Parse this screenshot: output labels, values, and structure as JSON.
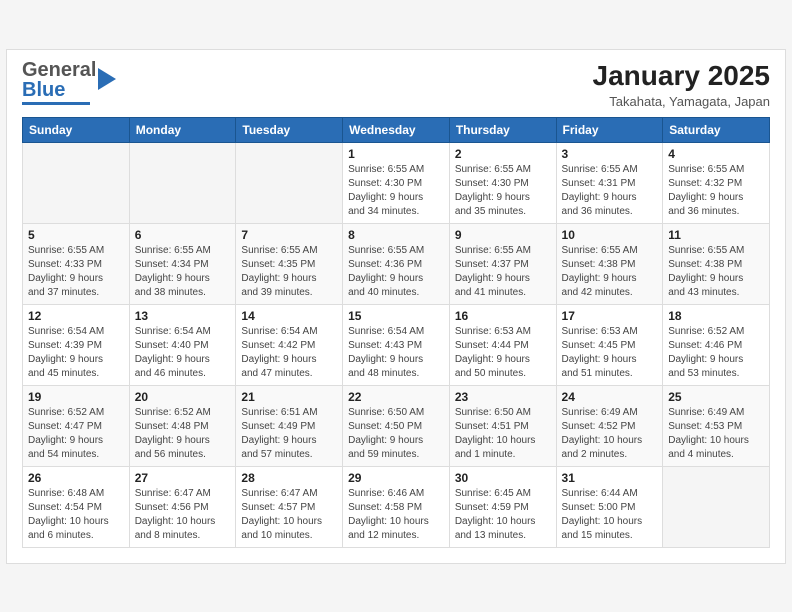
{
  "header": {
    "logo_general": "General",
    "logo_blue": "Blue",
    "month_title": "January 2025",
    "location": "Takahata, Yamagata, Japan"
  },
  "weekdays": [
    "Sunday",
    "Monday",
    "Tuesday",
    "Wednesday",
    "Thursday",
    "Friday",
    "Saturday"
  ],
  "weeks": [
    [
      {
        "day": "",
        "info": ""
      },
      {
        "day": "",
        "info": ""
      },
      {
        "day": "",
        "info": ""
      },
      {
        "day": "1",
        "info": "Sunrise: 6:55 AM\nSunset: 4:30 PM\nDaylight: 9 hours\nand 34 minutes."
      },
      {
        "day": "2",
        "info": "Sunrise: 6:55 AM\nSunset: 4:30 PM\nDaylight: 9 hours\nand 35 minutes."
      },
      {
        "day": "3",
        "info": "Sunrise: 6:55 AM\nSunset: 4:31 PM\nDaylight: 9 hours\nand 36 minutes."
      },
      {
        "day": "4",
        "info": "Sunrise: 6:55 AM\nSunset: 4:32 PM\nDaylight: 9 hours\nand 36 minutes."
      }
    ],
    [
      {
        "day": "5",
        "info": "Sunrise: 6:55 AM\nSunset: 4:33 PM\nDaylight: 9 hours\nand 37 minutes."
      },
      {
        "day": "6",
        "info": "Sunrise: 6:55 AM\nSunset: 4:34 PM\nDaylight: 9 hours\nand 38 minutes."
      },
      {
        "day": "7",
        "info": "Sunrise: 6:55 AM\nSunset: 4:35 PM\nDaylight: 9 hours\nand 39 minutes."
      },
      {
        "day": "8",
        "info": "Sunrise: 6:55 AM\nSunset: 4:36 PM\nDaylight: 9 hours\nand 40 minutes."
      },
      {
        "day": "9",
        "info": "Sunrise: 6:55 AM\nSunset: 4:37 PM\nDaylight: 9 hours\nand 41 minutes."
      },
      {
        "day": "10",
        "info": "Sunrise: 6:55 AM\nSunset: 4:38 PM\nDaylight: 9 hours\nand 42 minutes."
      },
      {
        "day": "11",
        "info": "Sunrise: 6:55 AM\nSunset: 4:38 PM\nDaylight: 9 hours\nand 43 minutes."
      }
    ],
    [
      {
        "day": "12",
        "info": "Sunrise: 6:54 AM\nSunset: 4:39 PM\nDaylight: 9 hours\nand 45 minutes."
      },
      {
        "day": "13",
        "info": "Sunrise: 6:54 AM\nSunset: 4:40 PM\nDaylight: 9 hours\nand 46 minutes."
      },
      {
        "day": "14",
        "info": "Sunrise: 6:54 AM\nSunset: 4:42 PM\nDaylight: 9 hours\nand 47 minutes."
      },
      {
        "day": "15",
        "info": "Sunrise: 6:54 AM\nSunset: 4:43 PM\nDaylight: 9 hours\nand 48 minutes."
      },
      {
        "day": "16",
        "info": "Sunrise: 6:53 AM\nSunset: 4:44 PM\nDaylight: 9 hours\nand 50 minutes."
      },
      {
        "day": "17",
        "info": "Sunrise: 6:53 AM\nSunset: 4:45 PM\nDaylight: 9 hours\nand 51 minutes."
      },
      {
        "day": "18",
        "info": "Sunrise: 6:52 AM\nSunset: 4:46 PM\nDaylight: 9 hours\nand 53 minutes."
      }
    ],
    [
      {
        "day": "19",
        "info": "Sunrise: 6:52 AM\nSunset: 4:47 PM\nDaylight: 9 hours\nand 54 minutes."
      },
      {
        "day": "20",
        "info": "Sunrise: 6:52 AM\nSunset: 4:48 PM\nDaylight: 9 hours\nand 56 minutes."
      },
      {
        "day": "21",
        "info": "Sunrise: 6:51 AM\nSunset: 4:49 PM\nDaylight: 9 hours\nand 57 minutes."
      },
      {
        "day": "22",
        "info": "Sunrise: 6:50 AM\nSunset: 4:50 PM\nDaylight: 9 hours\nand 59 minutes."
      },
      {
        "day": "23",
        "info": "Sunrise: 6:50 AM\nSunset: 4:51 PM\nDaylight: 10 hours\nand 1 minute."
      },
      {
        "day": "24",
        "info": "Sunrise: 6:49 AM\nSunset: 4:52 PM\nDaylight: 10 hours\nand 2 minutes."
      },
      {
        "day": "25",
        "info": "Sunrise: 6:49 AM\nSunset: 4:53 PM\nDaylight: 10 hours\nand 4 minutes."
      }
    ],
    [
      {
        "day": "26",
        "info": "Sunrise: 6:48 AM\nSunset: 4:54 PM\nDaylight: 10 hours\nand 6 minutes."
      },
      {
        "day": "27",
        "info": "Sunrise: 6:47 AM\nSunset: 4:56 PM\nDaylight: 10 hours\nand 8 minutes."
      },
      {
        "day": "28",
        "info": "Sunrise: 6:47 AM\nSunset: 4:57 PM\nDaylight: 10 hours\nand 10 minutes."
      },
      {
        "day": "29",
        "info": "Sunrise: 6:46 AM\nSunset: 4:58 PM\nDaylight: 10 hours\nand 12 minutes."
      },
      {
        "day": "30",
        "info": "Sunrise: 6:45 AM\nSunset: 4:59 PM\nDaylight: 10 hours\nand 13 minutes."
      },
      {
        "day": "31",
        "info": "Sunrise: 6:44 AM\nSunset: 5:00 PM\nDaylight: 10 hours\nand 15 minutes."
      },
      {
        "day": "",
        "info": ""
      }
    ]
  ]
}
